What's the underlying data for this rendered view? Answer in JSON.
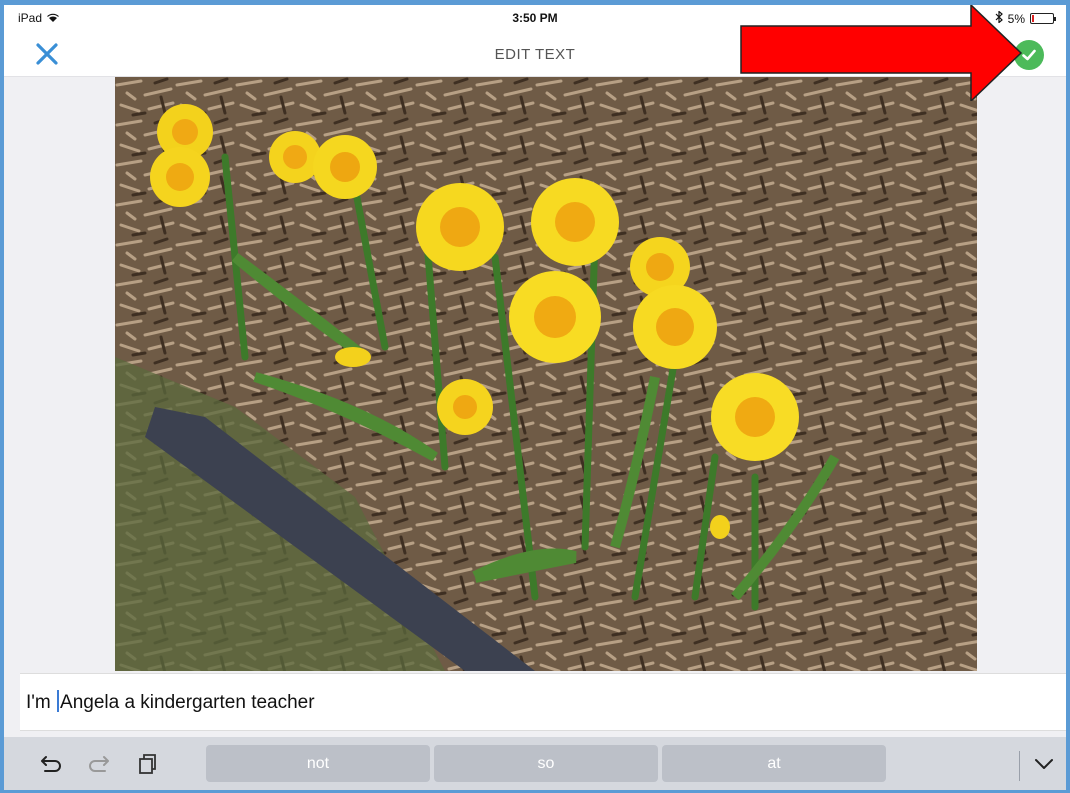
{
  "status_bar": {
    "device": "iPad",
    "time": "3:50 PM",
    "battery": "5%"
  },
  "nav": {
    "title": "EDIT TEXT",
    "close_icon": "close-icon",
    "done_icon": "checkmark-icon"
  },
  "editor": {
    "text_before_cursor": "I'm ",
    "text_after_cursor": "Angela a kindergarten teacher"
  },
  "keyboard": {
    "suggestions": [
      "not",
      "so",
      "at"
    ],
    "icons": [
      "undo-icon",
      "redo-icon",
      "paste-icon",
      "dismiss-keyboard-icon"
    ]
  },
  "colors": {
    "accent_blue": "#3a8fd6",
    "done_green": "#4cba5a",
    "annotation_red": "#ff0000",
    "frame_blue": "#5b9bd5"
  }
}
